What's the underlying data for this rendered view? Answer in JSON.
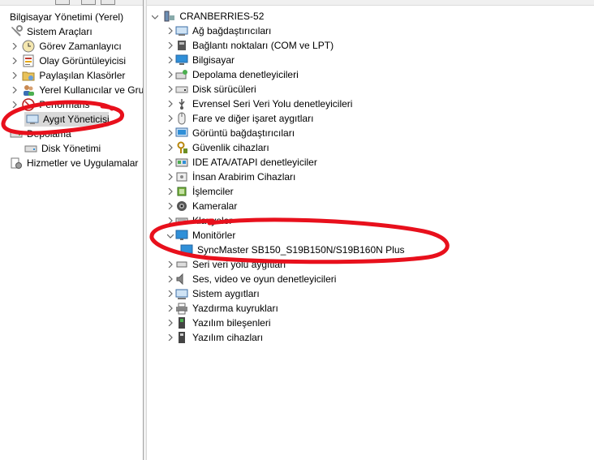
{
  "left_tree": {
    "root": "Bilgisayar Yönetimi (Yerel)",
    "items": [
      {
        "label": "Sistem Araçları"
      },
      {
        "label": "Görev Zamanlayıcı"
      },
      {
        "label": "Olay Görüntüleyicisi"
      },
      {
        "label": "Paylaşılan Klasörler"
      },
      {
        "label": "Yerel Kullanıcılar ve Gru"
      },
      {
        "label": "Performans"
      },
      {
        "label": "Aygıt Yöneticisi"
      },
      {
        "label": "Depolama"
      },
      {
        "label": "Disk Yönetimi"
      },
      {
        "label": "Hizmetler ve Uygulamalar"
      }
    ]
  },
  "device_tree": {
    "computer_name": "CRANBERRIES-52",
    "categories": [
      {
        "label": "Ağ bağdaştırıcıları"
      },
      {
        "label": "Bağlantı noktaları (COM ve LPT)"
      },
      {
        "label": "Bilgisayar"
      },
      {
        "label": "Depolama denetleyicileri"
      },
      {
        "label": "Disk sürücüleri"
      },
      {
        "label": "Evrensel Seri Veri Yolu denetleyicileri"
      },
      {
        "label": "Fare ve diğer işaret aygıtları"
      },
      {
        "label": "Görüntü bağdaştırıcıları"
      },
      {
        "label": "Güvenlik cihazları"
      },
      {
        "label": "IDE ATA/ATAPI denetleyiciler"
      },
      {
        "label": "İnsan Arabirim Cihazları"
      },
      {
        "label": "İşlemciler"
      },
      {
        "label": "Kameralar"
      },
      {
        "label": "Klavyeler"
      },
      {
        "label": "Monitörler"
      },
      {
        "label": "SyncMaster SB150_S19B150N/S19B160N Plus"
      },
      {
        "label": "Seri veri yolu aygıtları"
      },
      {
        "label": "Ses, video ve oyun denetleyicileri"
      },
      {
        "label": "Sistem aygıtları"
      },
      {
        "label": "Yazdırma kuyrukları"
      },
      {
        "label": "Yazılım bileşenleri"
      },
      {
        "label": "Yazılım cihazları"
      }
    ]
  },
  "colors": {
    "annotation": "#e8101c",
    "selection": "#d9d9d9",
    "monitor_icon": "#2f8fd8"
  }
}
